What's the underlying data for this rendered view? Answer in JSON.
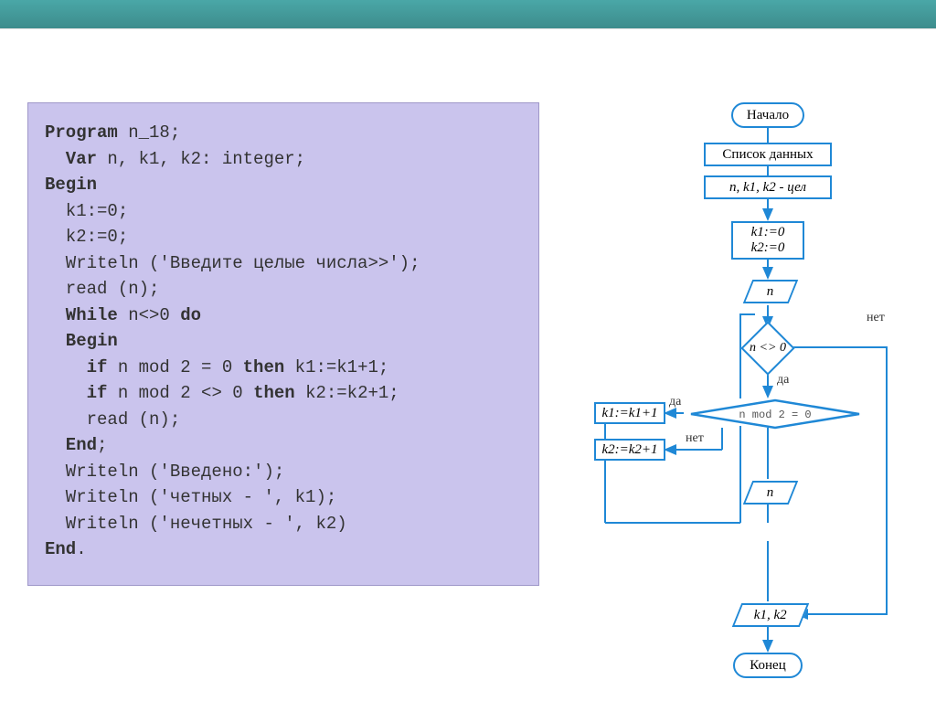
{
  "code": {
    "l01a": "Program",
    "l01b": " n_18;",
    "l02a": "  Var",
    "l02b": " n, k1, k2: integer;",
    "l03a": "Begin",
    "l04": "  k1:=0;",
    "l05": "  k2:=0;",
    "l06": "  Writeln ('Введите целые числа>>');",
    "l07": "  read (n);",
    "l08a": "  While",
    "l08b": " n<>0 ",
    "l08c": "do",
    "l09a": "  Begin",
    "l10a": "    if",
    "l10b": " n mod 2 = 0 ",
    "l10c": "then",
    "l10d": " k1:=k1+1;",
    "l11a": "    if",
    "l11b": " n mod 2 <> 0 ",
    "l11c": "then",
    "l11d": " k2:=k2+1;",
    "l12": "    read (n);",
    "l13a": "  End",
    "l13b": ";",
    "l14": "  Writeln ('Введено:');",
    "l15": "  Writeln ('четных - ', k1);",
    "l16": "  Writeln ('нечетных - ', k2)",
    "l17a": "End",
    "l17b": "."
  },
  "flow": {
    "start": "Начало",
    "dataList": "Список данных",
    "vars": "n, k1, k2 - цел",
    "init": "k1:=0\nk2:=0",
    "readN1": "n",
    "cond1": "n <> 0",
    "cond2": "n mod 2 = 0",
    "yes": "да",
    "no": "нет",
    "k1inc": "k1:=k1+1",
    "k2inc": "k2:=k2+1",
    "readN2": "n",
    "output": "k1, k2",
    "end": "Конец"
  }
}
